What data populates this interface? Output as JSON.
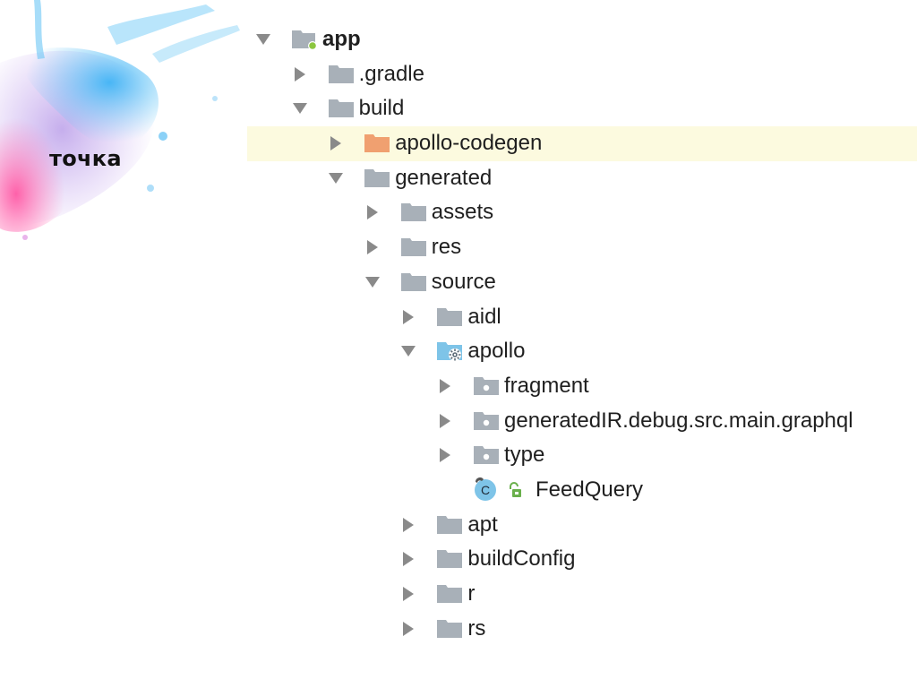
{
  "brand": {
    "text": "точка"
  },
  "tree": {
    "nodes": [
      {
        "id": "app",
        "label": "app",
        "depth": 0,
        "state": "expanded",
        "icon": "module-folder-icon",
        "bold": true,
        "selected": false
      },
      {
        "id": "gradle",
        "label": ".gradle",
        "depth": 1,
        "state": "collapsed",
        "icon": "folder-icon",
        "bold": false,
        "selected": false
      },
      {
        "id": "build",
        "label": "build",
        "depth": 1,
        "state": "expanded",
        "icon": "folder-icon",
        "bold": false,
        "selected": false
      },
      {
        "id": "apollo-codegen",
        "label": "apollo-codegen",
        "depth": 2,
        "state": "collapsed",
        "icon": "excluded-folder-icon",
        "bold": false,
        "selected": true
      },
      {
        "id": "generated",
        "label": "generated",
        "depth": 2,
        "state": "expanded",
        "icon": "folder-icon",
        "bold": false,
        "selected": false
      },
      {
        "id": "assets",
        "label": "assets",
        "depth": 3,
        "state": "collapsed",
        "icon": "folder-icon",
        "bold": false,
        "selected": false
      },
      {
        "id": "res",
        "label": "res",
        "depth": 3,
        "state": "collapsed",
        "icon": "folder-icon",
        "bold": false,
        "selected": false
      },
      {
        "id": "source",
        "label": "source",
        "depth": 3,
        "state": "expanded",
        "icon": "folder-icon",
        "bold": false,
        "selected": false
      },
      {
        "id": "aidl",
        "label": "aidl",
        "depth": 4,
        "state": "collapsed",
        "icon": "folder-icon",
        "bold": false,
        "selected": false
      },
      {
        "id": "apollo",
        "label": "apollo",
        "depth": 4,
        "state": "expanded",
        "icon": "generated-source-root-icon",
        "bold": false,
        "selected": false
      },
      {
        "id": "fragment",
        "label": "fragment",
        "depth": 5,
        "state": "collapsed",
        "icon": "package-icon",
        "bold": false,
        "selected": false
      },
      {
        "id": "generatedIR",
        "label": "generatedIR.debug.src.main.graphql",
        "depth": 5,
        "state": "collapsed",
        "icon": "package-icon",
        "bold": false,
        "selected": false
      },
      {
        "id": "type",
        "label": "type",
        "depth": 5,
        "state": "collapsed",
        "icon": "package-icon",
        "bold": false,
        "selected": false
      },
      {
        "id": "FeedQuery",
        "label": "FeedQuery",
        "depth": 5,
        "state": "leaf",
        "icon": "class-icon",
        "bold": false,
        "selected": false
      },
      {
        "id": "apt",
        "label": "apt",
        "depth": 4,
        "state": "collapsed",
        "icon": "folder-icon",
        "bold": false,
        "selected": false
      },
      {
        "id": "buildConfig",
        "label": "buildConfig",
        "depth": 4,
        "state": "collapsed",
        "icon": "folder-icon",
        "bold": false,
        "selected": false
      },
      {
        "id": "r",
        "label": "r",
        "depth": 4,
        "state": "collapsed",
        "icon": "folder-icon",
        "bold": false,
        "selected": false
      },
      {
        "id": "rs",
        "label": "rs",
        "depth": 4,
        "state": "collapsed",
        "icon": "folder-icon",
        "bold": false,
        "selected": false
      }
    ]
  },
  "colors": {
    "folder": "#a8b0b8",
    "excluded_folder": "#f0a070",
    "source_root": "#7ec4e8",
    "selection": "#fcfadf",
    "class_badge": "#7ec4e8",
    "module_dot": "#8cc63f",
    "lock": "#6ab04c"
  }
}
